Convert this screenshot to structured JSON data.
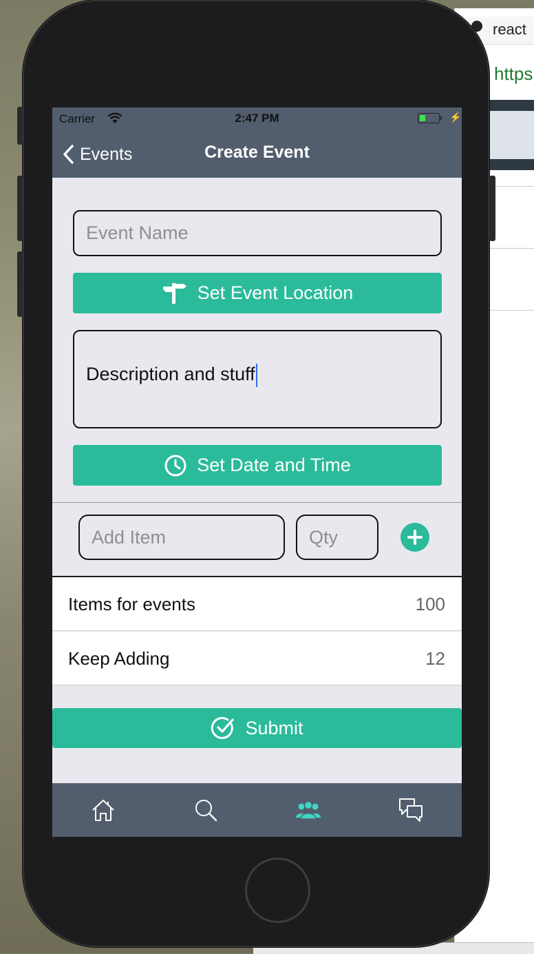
{
  "background": {
    "browser_tab_text": "react",
    "browser_url_text": "https:"
  },
  "status_bar": {
    "carrier": "Carrier",
    "time": "2:47 PM",
    "battery_level": 0.3
  },
  "nav_bar": {
    "back_label": "Events",
    "title": "Create Event"
  },
  "form": {
    "event_name_placeholder": "Event Name",
    "event_name_value": "",
    "location_button_label": "Set Event Location",
    "description_value": "Description and stuff",
    "date_time_button_label": "Set Date and Time",
    "add_item_placeholder": "Add Item",
    "qty_placeholder": "Qty"
  },
  "items": [
    {
      "name": "Items for events",
      "qty": "100"
    },
    {
      "name": "Keep Adding",
      "qty": "12"
    }
  ],
  "submit_label": "Submit",
  "tabs": [
    {
      "icon": "home-icon",
      "active": false
    },
    {
      "icon": "search-icon",
      "active": false
    },
    {
      "icon": "users-icon",
      "active": true
    },
    {
      "icon": "chat-icon",
      "active": false
    }
  ],
  "colors": {
    "accent": "#2bbb9a",
    "bar": "#525e6e",
    "active_tab": "#3fd6c4",
    "inactive_tab": "#ffffff"
  }
}
